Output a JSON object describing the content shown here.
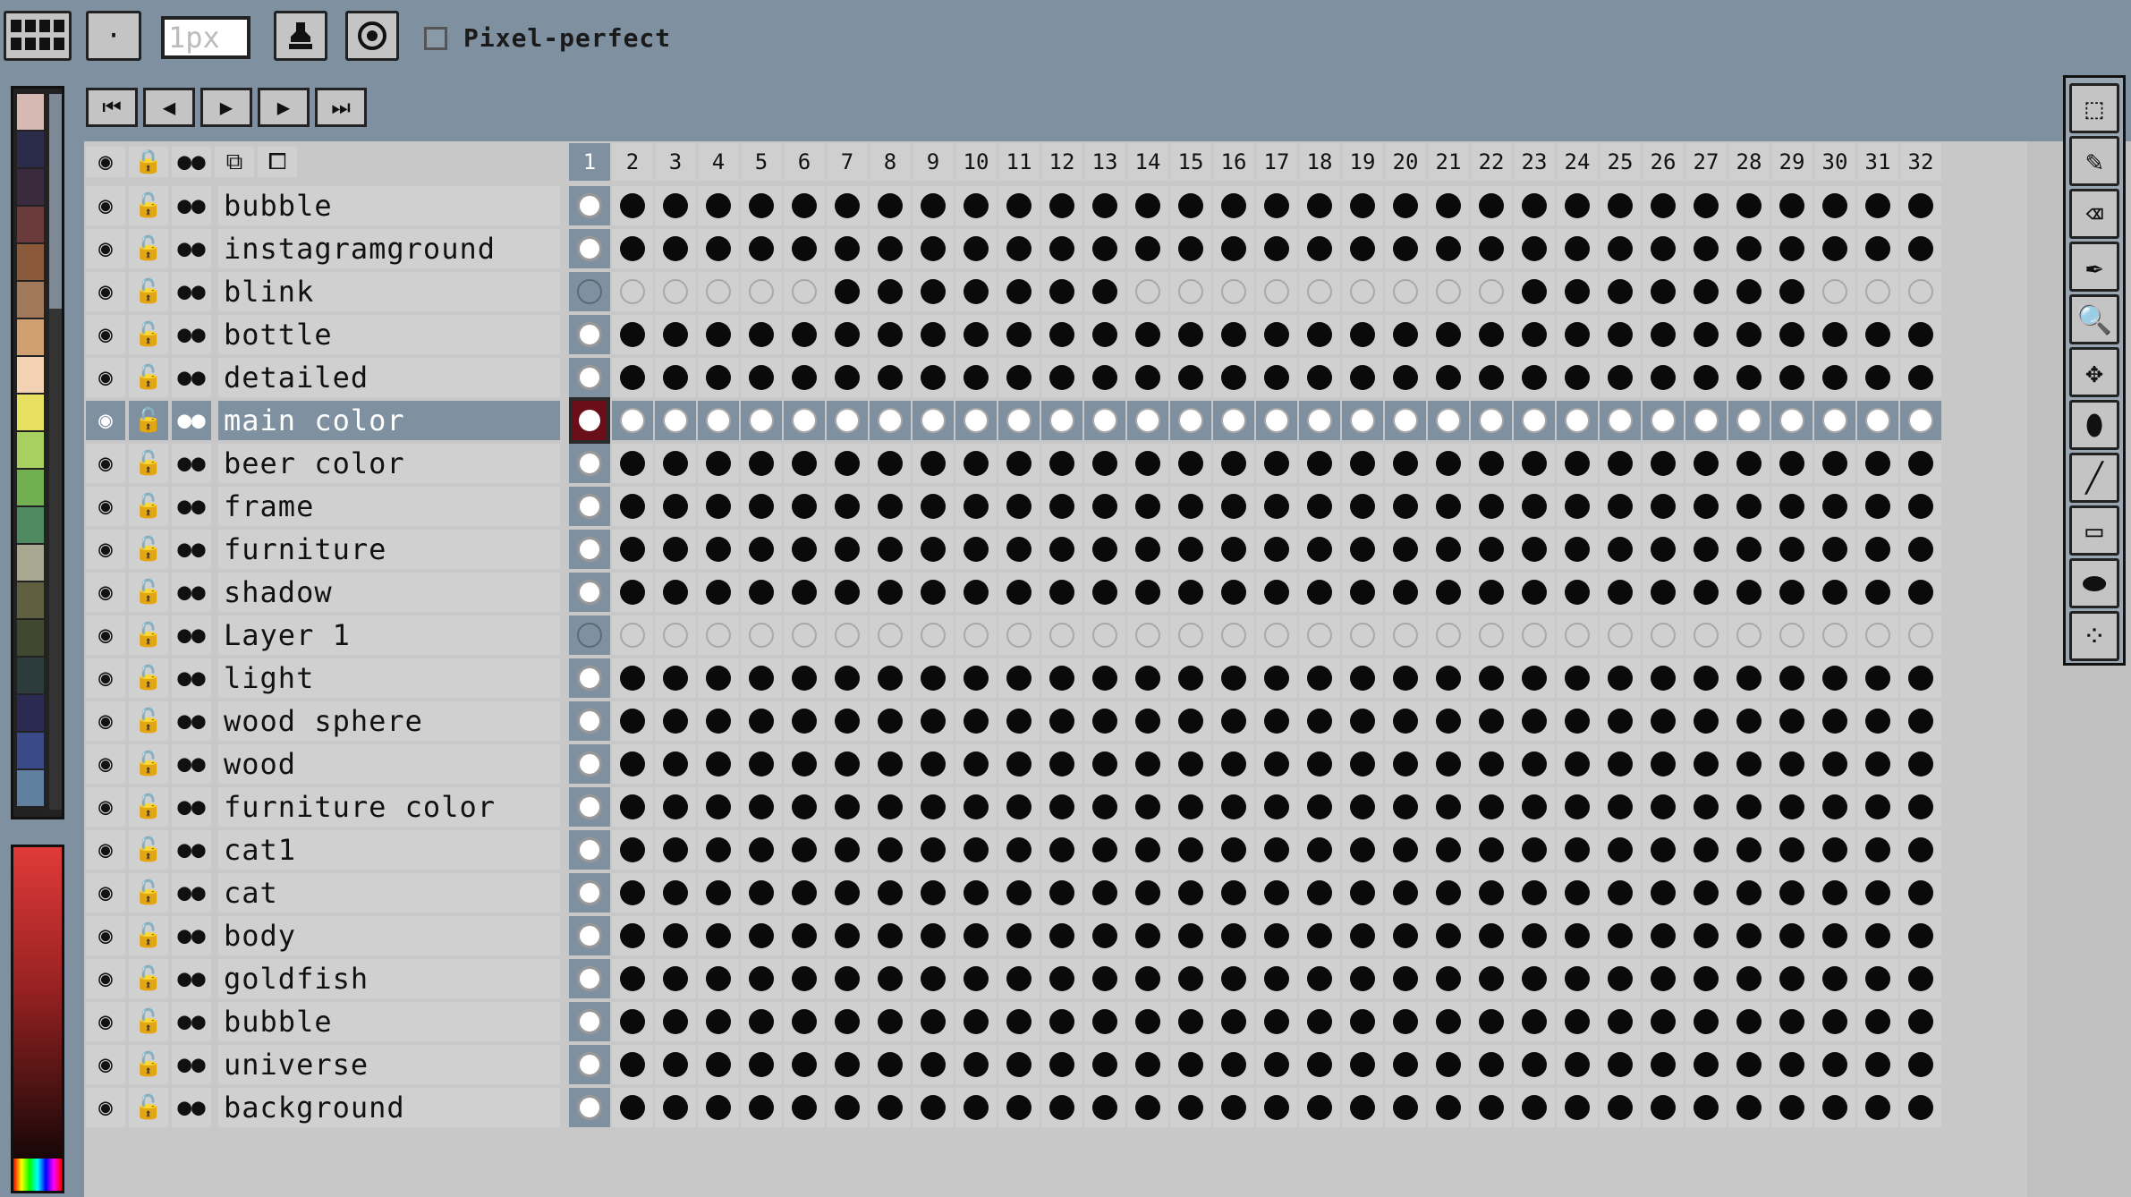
{
  "toolbar": {
    "brush_size": "1px",
    "pixel_perfect_label": "Pixel-perfect",
    "pixel_perfect_checked": false
  },
  "playback": {
    "buttons": [
      {
        "name": "first-frame",
        "icon": "skip-back-icon",
        "glyph": "⏮"
      },
      {
        "name": "prev-frame",
        "icon": "step-back-icon",
        "glyph": "◀"
      },
      {
        "name": "play",
        "icon": "play-icon",
        "glyph": "▶"
      },
      {
        "name": "next-frame",
        "icon": "step-forward-icon",
        "glyph": "▶"
      },
      {
        "name": "last-frame",
        "icon": "skip-forward-icon",
        "glyph": "⏭"
      }
    ]
  },
  "palette": {
    "colors": [
      "#d6b9b3",
      "#2b2b4a",
      "#3a2a3e",
      "#6b3a3a",
      "#8a5a3a",
      "#a07a5a",
      "#d1a070",
      "#f2d2b2",
      "#e8e060",
      "#a8d060",
      "#70b050",
      "#508a60",
      "#a8a890",
      "#606040",
      "#404830",
      "#2c3c3c",
      "#2a2a52",
      "#3a4a88",
      "#6080a0"
    ]
  },
  "timeline": {
    "active_frame": 1,
    "frames": [
      "1",
      "2",
      "3",
      "4",
      "5",
      "6",
      "7",
      "8",
      "9",
      "10",
      "11",
      "12",
      "13",
      "14",
      "15",
      "16",
      "17",
      "18",
      "19",
      "20",
      "21",
      "22",
      "23",
      "24",
      "25",
      "26",
      "27",
      "28",
      "29",
      "30",
      "31",
      "32"
    ],
    "selected_layer": "main color",
    "layers": [
      {
        "name": "bubble",
        "cels": "full"
      },
      {
        "name": "instagramground",
        "cels": "full"
      },
      {
        "name": "blink",
        "cels": "custom",
        "pattern": [
          7,
          8,
          9,
          10,
          11,
          12,
          13,
          23,
          24,
          25,
          26,
          27,
          28,
          29
        ]
      },
      {
        "name": "bottle",
        "cels": "full"
      },
      {
        "name": "detailed",
        "cels": "full"
      },
      {
        "name": "main color",
        "cels": "empty"
      },
      {
        "name": "beer color",
        "cels": "full"
      },
      {
        "name": "frame",
        "cels": "full"
      },
      {
        "name": "furniture",
        "cels": "full"
      },
      {
        "name": "shadow",
        "cels": "full"
      },
      {
        "name": "Layer 1",
        "cels": "none"
      },
      {
        "name": "light",
        "cels": "full"
      },
      {
        "name": "wood sphere",
        "cels": "full"
      },
      {
        "name": "wood",
        "cels": "full"
      },
      {
        "name": "furniture color",
        "cels": "full"
      },
      {
        "name": "cat1",
        "cels": "full"
      },
      {
        "name": "cat",
        "cels": "full"
      },
      {
        "name": "body",
        "cels": "full"
      },
      {
        "name": "goldfish",
        "cels": "full"
      },
      {
        "name": "bubble",
        "cels": "full"
      },
      {
        "name": "universe",
        "cels": "full"
      },
      {
        "name": "background",
        "cels": "full"
      }
    ]
  },
  "tools": [
    {
      "name": "rectangle-select",
      "icon": "marquee-icon",
      "glyph": "⬚"
    },
    {
      "name": "pencil",
      "icon": "pencil-icon",
      "glyph": "✎"
    },
    {
      "name": "eraser",
      "icon": "eraser-icon",
      "glyph": "⌫"
    },
    {
      "name": "eyedropper",
      "icon": "eyedropper-icon",
      "glyph": "✒"
    },
    {
      "name": "zoom",
      "icon": "magnifier-icon",
      "glyph": "🔍"
    },
    {
      "name": "move",
      "icon": "move-icon",
      "glyph": "✥"
    },
    {
      "name": "fill",
      "icon": "bucket-icon",
      "glyph": "⬮"
    },
    {
      "name": "line",
      "icon": "line-icon",
      "glyph": "╱"
    },
    {
      "name": "rectangle",
      "icon": "rectangle-icon",
      "glyph": "▭"
    },
    {
      "name": "ellipse",
      "icon": "ellipse-icon",
      "glyph": "⬬"
    },
    {
      "name": "dither",
      "icon": "dither-brush-icon",
      "glyph": "⁘"
    }
  ]
}
